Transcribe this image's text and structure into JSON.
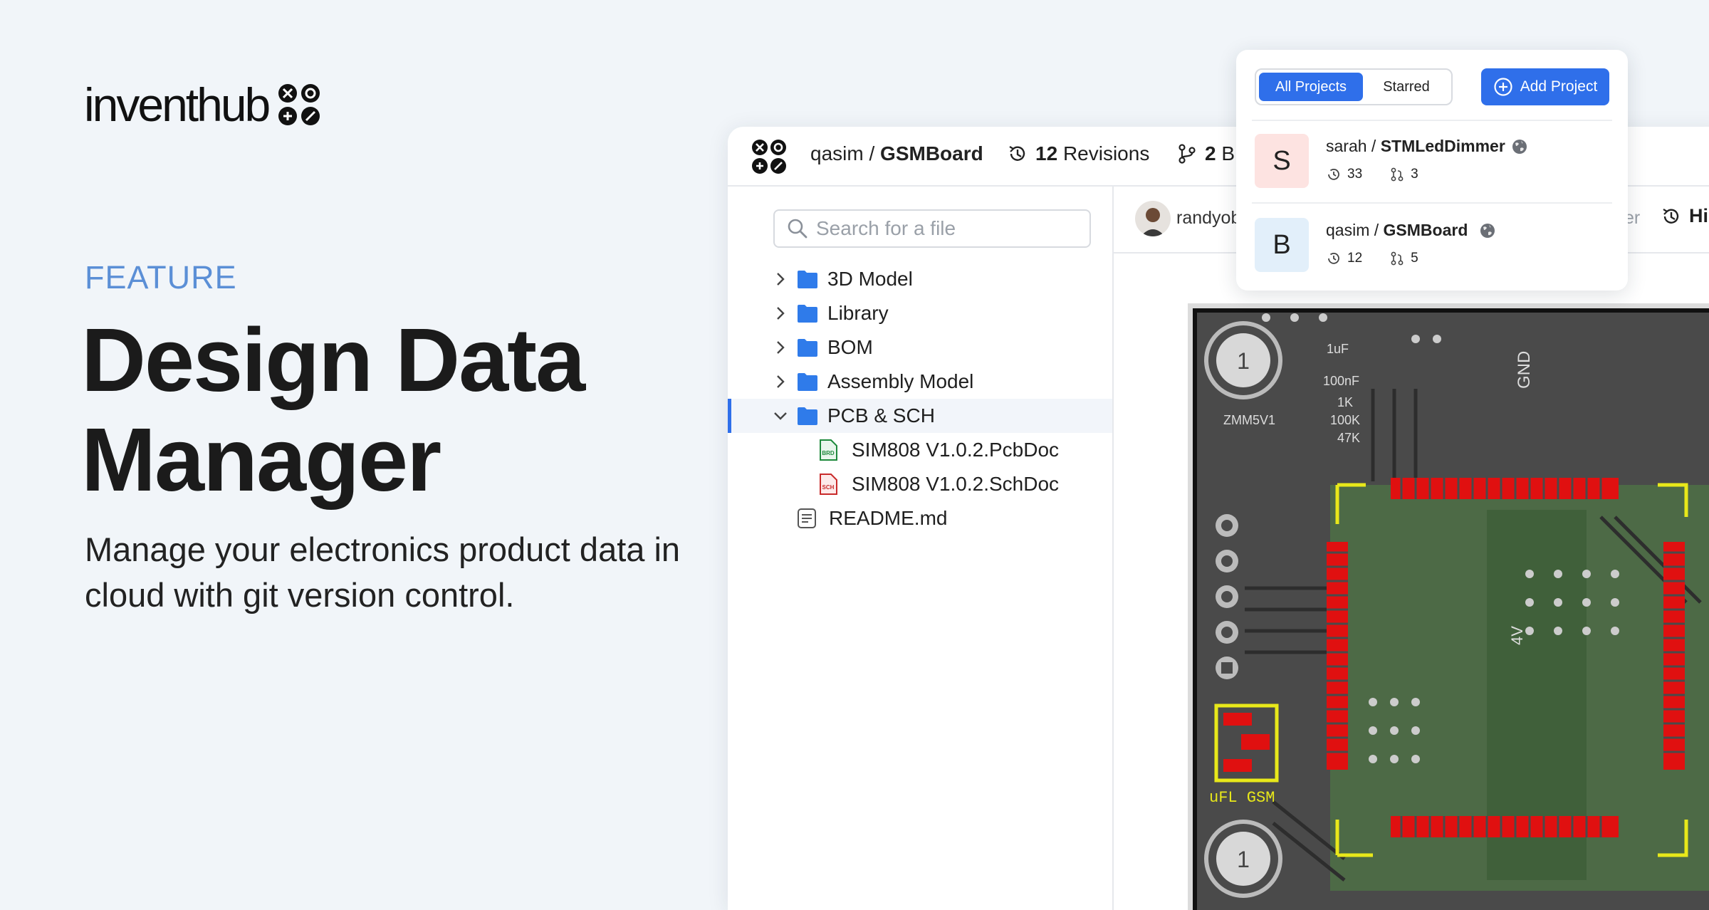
{
  "brand": {
    "name": "inventhub"
  },
  "hero": {
    "eyebrow": "FEATURE",
    "title_line1": "Design Data",
    "title_line2": "Manager",
    "subtitle_line1": "Manage your electronics product data in",
    "subtitle_line2": "cloud with git version control."
  },
  "app": {
    "crumb_owner": "qasim",
    "crumb_sep": " / ",
    "crumb_repo": "GSMBoard",
    "revisions_count": "12",
    "revisions_label": "Revisions",
    "branches_count": "2",
    "branches_label": "B",
    "search_placeholder": "Search for a file",
    "tree": [
      {
        "label": "3D Model"
      },
      {
        "label": "Library"
      },
      {
        "label": "BOM"
      },
      {
        "label": "Assembly Model"
      },
      {
        "label": "PCB & SCH"
      }
    ],
    "files": [
      {
        "label": "SIM808 V1.0.2.PcbDoc",
        "badge": "BRD"
      },
      {
        "label": "SIM808 V1.0.2.SchDoc",
        "badge": "SCH"
      }
    ],
    "readme": "README.md",
    "preview_user": "randyob",
    "preview_branch_tail": "ter",
    "preview_history": "His"
  },
  "dropdown": {
    "tab_all": "All Projects",
    "tab_starred": "Starred",
    "add_label": "Add Project",
    "projects": [
      {
        "initial": "S",
        "owner": "sarah",
        "sep": " / ",
        "name": "STMLedDimmer",
        "revisions": "33",
        "branches": "3",
        "avatar_color": "#fde3e1"
      },
      {
        "initial": "B",
        "owner": "qasim",
        "sep": " / ",
        "name": "GSMBoard",
        "revisions": "12",
        "branches": "5",
        "avatar_color": "#e2effa"
      }
    ]
  },
  "colors": {
    "accent": "#2f6fea",
    "eyebrow": "#5b8fd6",
    "background": "#f1f5f9"
  },
  "icons": [
    "search-icon",
    "chevron-right-icon",
    "chevron-down-icon",
    "folder-icon",
    "brd-file-icon",
    "sch-file-icon",
    "document-icon",
    "history-icon",
    "branch-icon",
    "globe-icon",
    "plus-circle-icon"
  ]
}
